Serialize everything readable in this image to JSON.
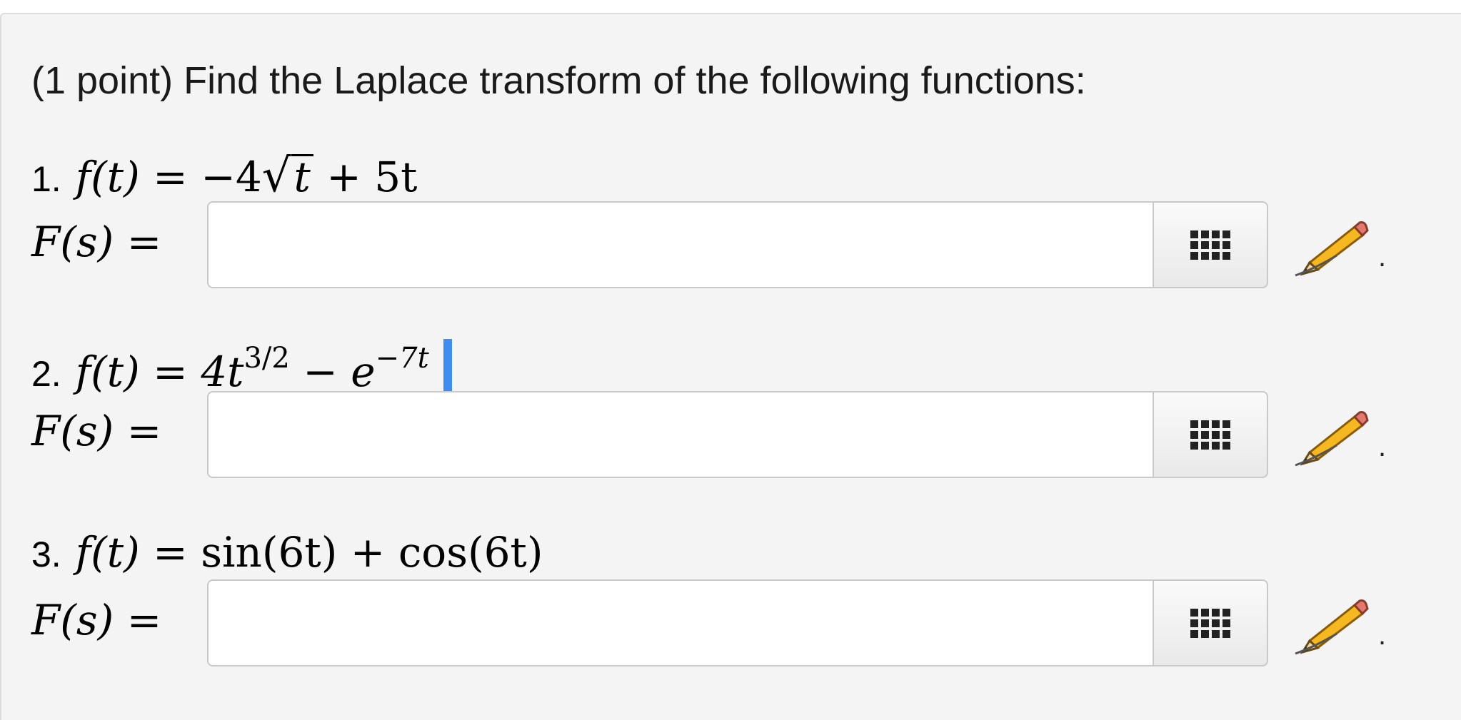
{
  "intro": "(1 point) Find the Laplace transform of the following functions:",
  "problems": [
    {
      "number": "1.",
      "f_lhs": "f(t) = ",
      "parts": {
        "a": "−4",
        "b": "t",
        "c": " + 5t"
      },
      "answer_label": "F(s) = ",
      "answer_value": "",
      "trailing": "."
    },
    {
      "number": "2.",
      "f_lhs": "f(t) = ",
      "parts": {
        "a": "4t",
        "b": "3/2",
        "c": " − e",
        "d": "−7t"
      },
      "answer_label": "F(s) = ",
      "answer_value": "",
      "trailing": "."
    },
    {
      "number": "3.",
      "f_lhs": "f(t) = ",
      "parts": {
        "a": "sin(6t) + cos(6t)"
      },
      "answer_label": "F(s) = ",
      "answer_value": "",
      "trailing": "."
    }
  ],
  "icons": {
    "grid_button": "grid-icon",
    "edit": "pencil-icon"
  },
  "colors": {
    "panel_bg": "#f4f4f4",
    "caret": "#3d8ef0"
  }
}
